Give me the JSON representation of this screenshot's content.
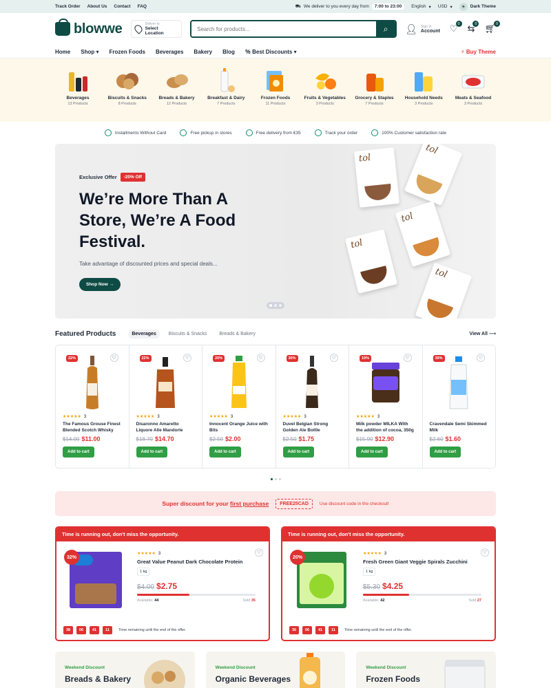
{
  "topbar": {
    "links": [
      "Track Order",
      "About Us",
      "Contact",
      "FAQ"
    ],
    "delivery_text": "We deliver to you every day from",
    "hours": "7:00 to 23:00",
    "language": "English",
    "currency": "USD",
    "theme": "Dark Theme"
  },
  "header": {
    "logo": "blowwe",
    "location_small": "Deliver to",
    "location_main": "Select Location",
    "search_placeholder": "Search for products...",
    "account_small": "Sign In",
    "account_main": "Account",
    "wishlist_count": "0",
    "compare_count": "0",
    "cart_count": "0"
  },
  "nav": {
    "items": [
      "Home",
      "Shop",
      "Frozen Foods",
      "Beverages",
      "Bakery",
      "Blog",
      "Best Discounts"
    ],
    "buy_theme": "Buy Theme"
  },
  "categories": [
    {
      "name": "Beverages",
      "count": "13 Products",
      "icon": "beverage-bottles-icon"
    },
    {
      "name": "Biscuits & Snacks",
      "count": "8 Products",
      "icon": "cookies-icon"
    },
    {
      "name": "Breads & Bakery",
      "count": "12 Products",
      "icon": "bread-icon"
    },
    {
      "name": "Breakfast & Dairy",
      "count": "7 Products",
      "icon": "milk-icon"
    },
    {
      "name": "Frozen Foods",
      "count": "11 Products",
      "icon": "frozen-box-icon"
    },
    {
      "name": "Fruits & Vegetables",
      "count": "3 Products",
      "icon": "fruits-icon"
    },
    {
      "name": "Grocery & Staples",
      "count": "7 Products",
      "icon": "grocery-icon"
    },
    {
      "name": "Household Needs",
      "count": "3 Products",
      "icon": "detergent-icon"
    },
    {
      "name": "Meats & Seafood",
      "count": "3 Products",
      "icon": "meat-icon"
    }
  ],
  "features": [
    "Installments Without Card",
    "Free pickup in stores",
    "Free delivery from €35",
    "Track your order",
    "100% Customer satisfaction rate"
  ],
  "hero": {
    "exclusive": "Exclusive Offer",
    "off": "-20% Off",
    "title_line1": "We’re More Than A",
    "title_line2": "Store, We’re A Food",
    "title_line3": "Festival.",
    "subtitle": "Take advantage of discounted prices and special deals...",
    "button": "Shop Now",
    "box_brand": "tol"
  },
  "featured": {
    "title": "Featured Products",
    "tabs": [
      "Beverages",
      "Biscuits & Snacks",
      "Breads & Bakery"
    ],
    "view_all": "View All",
    "add_label": "Add to cart",
    "products": [
      {
        "discount": "22%",
        "rating": "3",
        "name": "The Famous Grouse Finest Blended Scotch Whisky",
        "old": "$14.00",
        "price": "$11.00"
      },
      {
        "discount": "22%",
        "rating": "3",
        "name": "Disaronno Amaretto Liquore Alle Mandorle",
        "old": "$18.70",
        "price": "$14.70"
      },
      {
        "discount": "20%",
        "rating": "3",
        "name": "Innocent Orange Juice with Bits",
        "old": "$2.50",
        "price": "$2.00"
      },
      {
        "discount": "30%",
        "rating": "3",
        "name": "Duvel Belgian Strong Golden Ale Bottle",
        "old": "$2.50",
        "price": "$1.75"
      },
      {
        "discount": "19%",
        "rating": "3",
        "name": "Milk powder MILKA With the addition of cocoa, 350g",
        "old": "$15.90",
        "price": "$12.90"
      },
      {
        "discount": "39%",
        "rating": "",
        "name": "Cravendale Semi Skimmed Milk",
        "old": "$2.60",
        "price": "$1.60"
      }
    ]
  },
  "promo": {
    "text_before": "Super discount for your",
    "text_link": "first purchase",
    "code": "FREE25CAD",
    "sub": "Use discount code in the checkout!"
  },
  "deals": [
    {
      "head": "Time is running out, don't miss the opportunity.",
      "badge": "32%",
      "rating": "3",
      "name": "Great Value Peanut Dark Chocolate Protein",
      "unit": "1 kg",
      "old": "$4.00",
      "price": "$2.75",
      "available_label": "Available:",
      "available": "44",
      "sold_label": "Sold:",
      "sold": "35",
      "progress": 0.44,
      "timer": [
        "38",
        "06",
        "41",
        "11"
      ],
      "timer_label": "Time remaining until the end of the offer."
    },
    {
      "head": "Time is running out, don't miss the opportunity.",
      "badge": "20%",
      "rating": "3",
      "name": "Fresh Green Giant Veggie Spirals Zucchini",
      "unit": "1 kg",
      "old": "$5.30",
      "price": "$4.25",
      "available_label": "Available:",
      "available": "42",
      "sold_label": "Sold:",
      "sold": "27",
      "progress": 0.39,
      "timer": [
        "36",
        "06",
        "41",
        "11"
      ],
      "timer_label": "Time remaining until the end of the offer."
    }
  ],
  "weekend": [
    {
      "tag": "Weekend Discount",
      "name": "Breads & Bakery"
    },
    {
      "tag": "Weekend Discount",
      "name": "Organic Beverages"
    },
    {
      "tag": "Weekend Discount",
      "name": "Frozen Foods"
    }
  ],
  "colors": {
    "brand": "#0f4b45",
    "red": "#e03131",
    "green": "#2f9e44"
  }
}
